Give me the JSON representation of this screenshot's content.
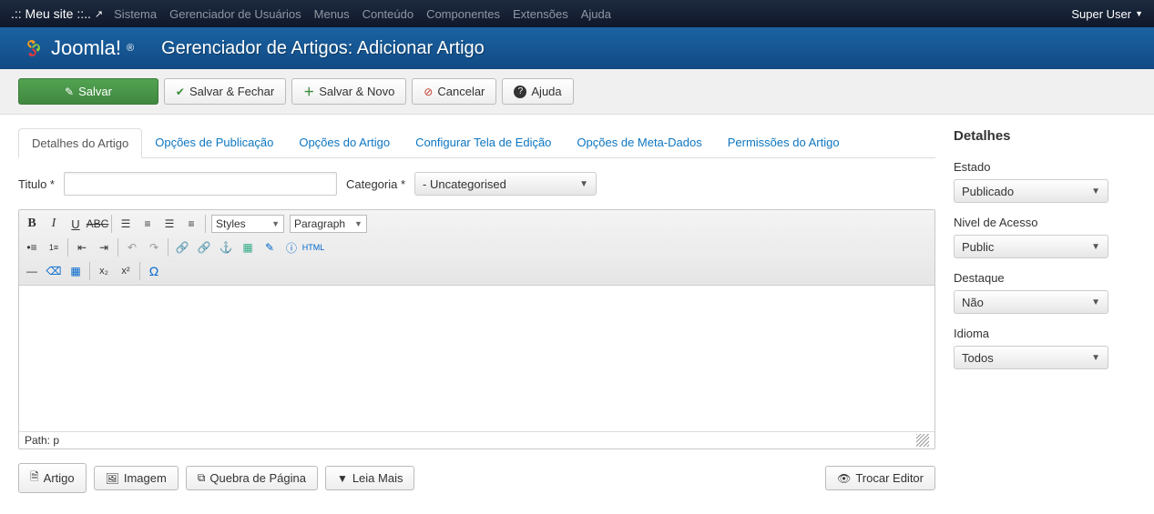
{
  "topnav": {
    "site_name": ".:: Meu site ::..",
    "menu": [
      "Sistema",
      "Gerenciador de Usuários",
      "Menus",
      "Conteúdo",
      "Componentes",
      "Extensões",
      "Ajuda"
    ],
    "user": "Super User"
  },
  "header": {
    "logo_text": "Joomla!",
    "page_title": "Gerenciador de Artigos: Adicionar Artigo"
  },
  "toolbar": {
    "save": "Salvar",
    "save_close": "Salvar & Fechar",
    "save_new": "Salvar & Novo",
    "cancel": "Cancelar",
    "help": "Ajuda"
  },
  "tabs": [
    "Detalhes do Artigo",
    "Opções de Publicação",
    "Opções do Artigo",
    "Configurar Tela de Edição",
    "Opções de Meta-Dados",
    "Permissões do Artigo"
  ],
  "form": {
    "title_label": "Titulo *",
    "title_value": "",
    "category_label": "Categoria *",
    "category_value": "- Uncategorised"
  },
  "editor": {
    "styles_label": "Styles",
    "format_label": "Paragraph",
    "html_label": "HTML",
    "path_label": "Path: p"
  },
  "under_buttons": {
    "artigo": "Artigo",
    "imagem": "Imagem",
    "pagebreak": "Quebra de Página",
    "readmore": "Leia Mais",
    "toggle": "Trocar Editor"
  },
  "side": {
    "heading": "Detalhes",
    "estado_label": "Estado",
    "estado_value": "Publicado",
    "acesso_label": "Nivel de Acesso",
    "acesso_value": "Public",
    "destaque_label": "Destaque",
    "destaque_value": "Não",
    "idioma_label": "Idioma",
    "idioma_value": "Todos"
  }
}
